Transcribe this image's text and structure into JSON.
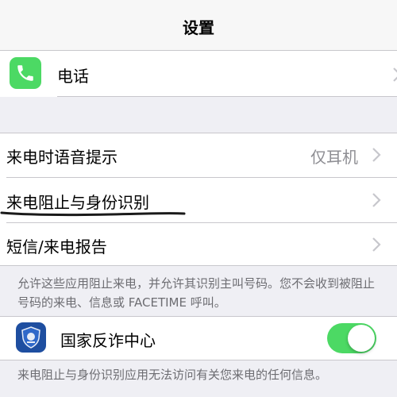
{
  "navbar": {
    "title": "设置"
  },
  "phone_row": {
    "label": "电话"
  },
  "call_settings": {
    "voice_prompt": {
      "label": "来电时语音提示",
      "value": "仅耳机"
    },
    "block_identify": {
      "label": "来电阻止与身份识别"
    },
    "sms_report": {
      "label": "短信/来电报告"
    }
  },
  "apps_footer": "允许这些应用阻止来电，并允许其识别主叫号码。您不会收到被阻止号码的来电、信息或 FACETIME 呼叫。",
  "app_row": {
    "label": "国家反诈中心",
    "enabled": true
  },
  "bottom_footer": "来电阻止与身份识别应用无法访问有关您来电的任何信息。",
  "colors": {
    "phone_icon": "#4cd964",
    "toggle_on": "#4cd964",
    "antifraud_icon": "#1e4ea0"
  }
}
